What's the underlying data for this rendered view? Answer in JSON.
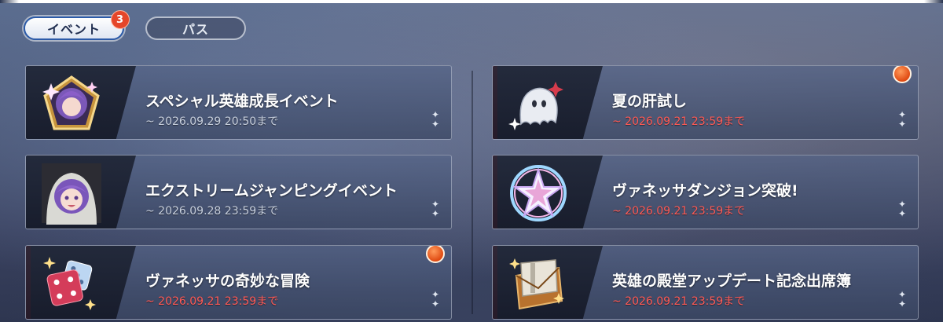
{
  "tabs": [
    {
      "label": "イベント",
      "badge": "3",
      "active": true
    },
    {
      "label": "パス",
      "active": false
    }
  ],
  "colors": {
    "accent_red": "#d33a48",
    "badge": "#e5462a",
    "date_red": "#ff5a55"
  },
  "events_left": [
    {
      "title": "スペシャル英雄成長イベント",
      "date": "~ 2026.09.29 20:50まで",
      "icon": "hero-portrait-pentagon-icon",
      "limited": false,
      "new": false
    },
    {
      "title": "エクストリームジャンピングイベント",
      "date": "~ 2026.09.28 23:59まで",
      "icon": "hero-portrait-hood-icon",
      "limited": false,
      "new": false
    },
    {
      "title": "ヴァネッサの奇妙な冒険",
      "date": "~ 2026.09.21 23:59まで",
      "icon": "dice-icon",
      "limited": true,
      "new": true
    }
  ],
  "events_right": [
    {
      "title": "夏の肝試し",
      "date": "~ 2026.09.21 23:59まで",
      "icon": "ghost-icon",
      "limited": true,
      "new": true
    },
    {
      "title": "ヴァネッサダンジョン突破!",
      "date": "~ 2026.09.21 23:59まで",
      "icon": "star-crystal-icon",
      "limited": true,
      "new": false
    },
    {
      "title": "英雄の殿堂アップデート記念出席簿",
      "date": "~ 2026.09.21 23:59まで",
      "icon": "attendance-book-icon",
      "limited": true,
      "new": false
    }
  ]
}
